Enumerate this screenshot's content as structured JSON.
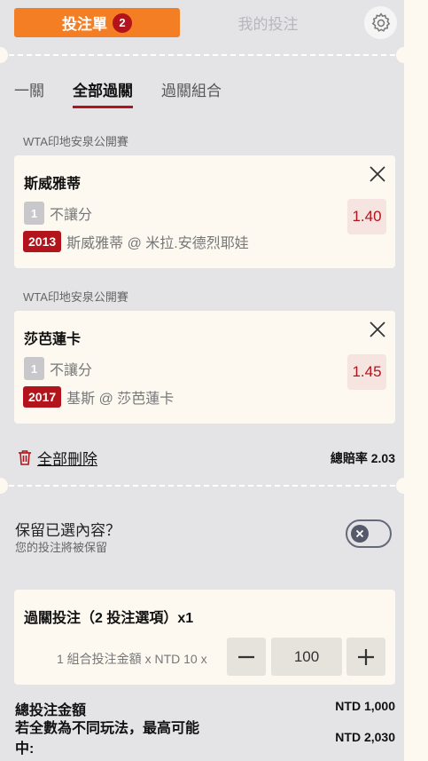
{
  "header": {
    "betslip_label": "投注單",
    "betslip_count": "2",
    "mybets_label": "我的投注"
  },
  "subtabs": [
    {
      "label": "一關"
    },
    {
      "label": "全部過關"
    },
    {
      "label": "過關組合"
    }
  ],
  "selections": [
    {
      "league": "WTA印地安泉公開賽",
      "team": "斯威雅蒂",
      "line_num": "1",
      "line_text": "不讓分",
      "match_id": "2013",
      "match": "斯威雅蒂 @ 米拉.安德烈耶娃",
      "odds": "1.40"
    },
    {
      "league": "WTA印地安泉公開賽",
      "team": "莎芭蓮卡",
      "line_num": "1",
      "line_text": "不讓分",
      "match_id": "2017",
      "match": "基斯 @ 莎芭蓮卡",
      "odds": "1.45"
    }
  ],
  "footer": {
    "delete_all_label": "全部刪除",
    "total_odds": "總賠率 2.03"
  },
  "keep": {
    "title": "保留已選內容？",
    "subtitle": "您的投注將被保留"
  },
  "parlay": {
    "title": "過關投注（2 投注選項）x1",
    "combo_text": "1 組合投注金額 x NTD 10 x",
    "stake_value": "100"
  },
  "totals": {
    "total_label": "總投注金額",
    "total_value": "NTD 1,000",
    "max_win_label": "若全數為不同玩法，最高可能中:",
    "max_win_value": "NTD 2,030"
  },
  "colors": {
    "accent_orange": "#f47e23",
    "brand_red": "#b3131b",
    "panel_grey": "#e4e4e6",
    "card_cream": "#fdf9f1"
  }
}
